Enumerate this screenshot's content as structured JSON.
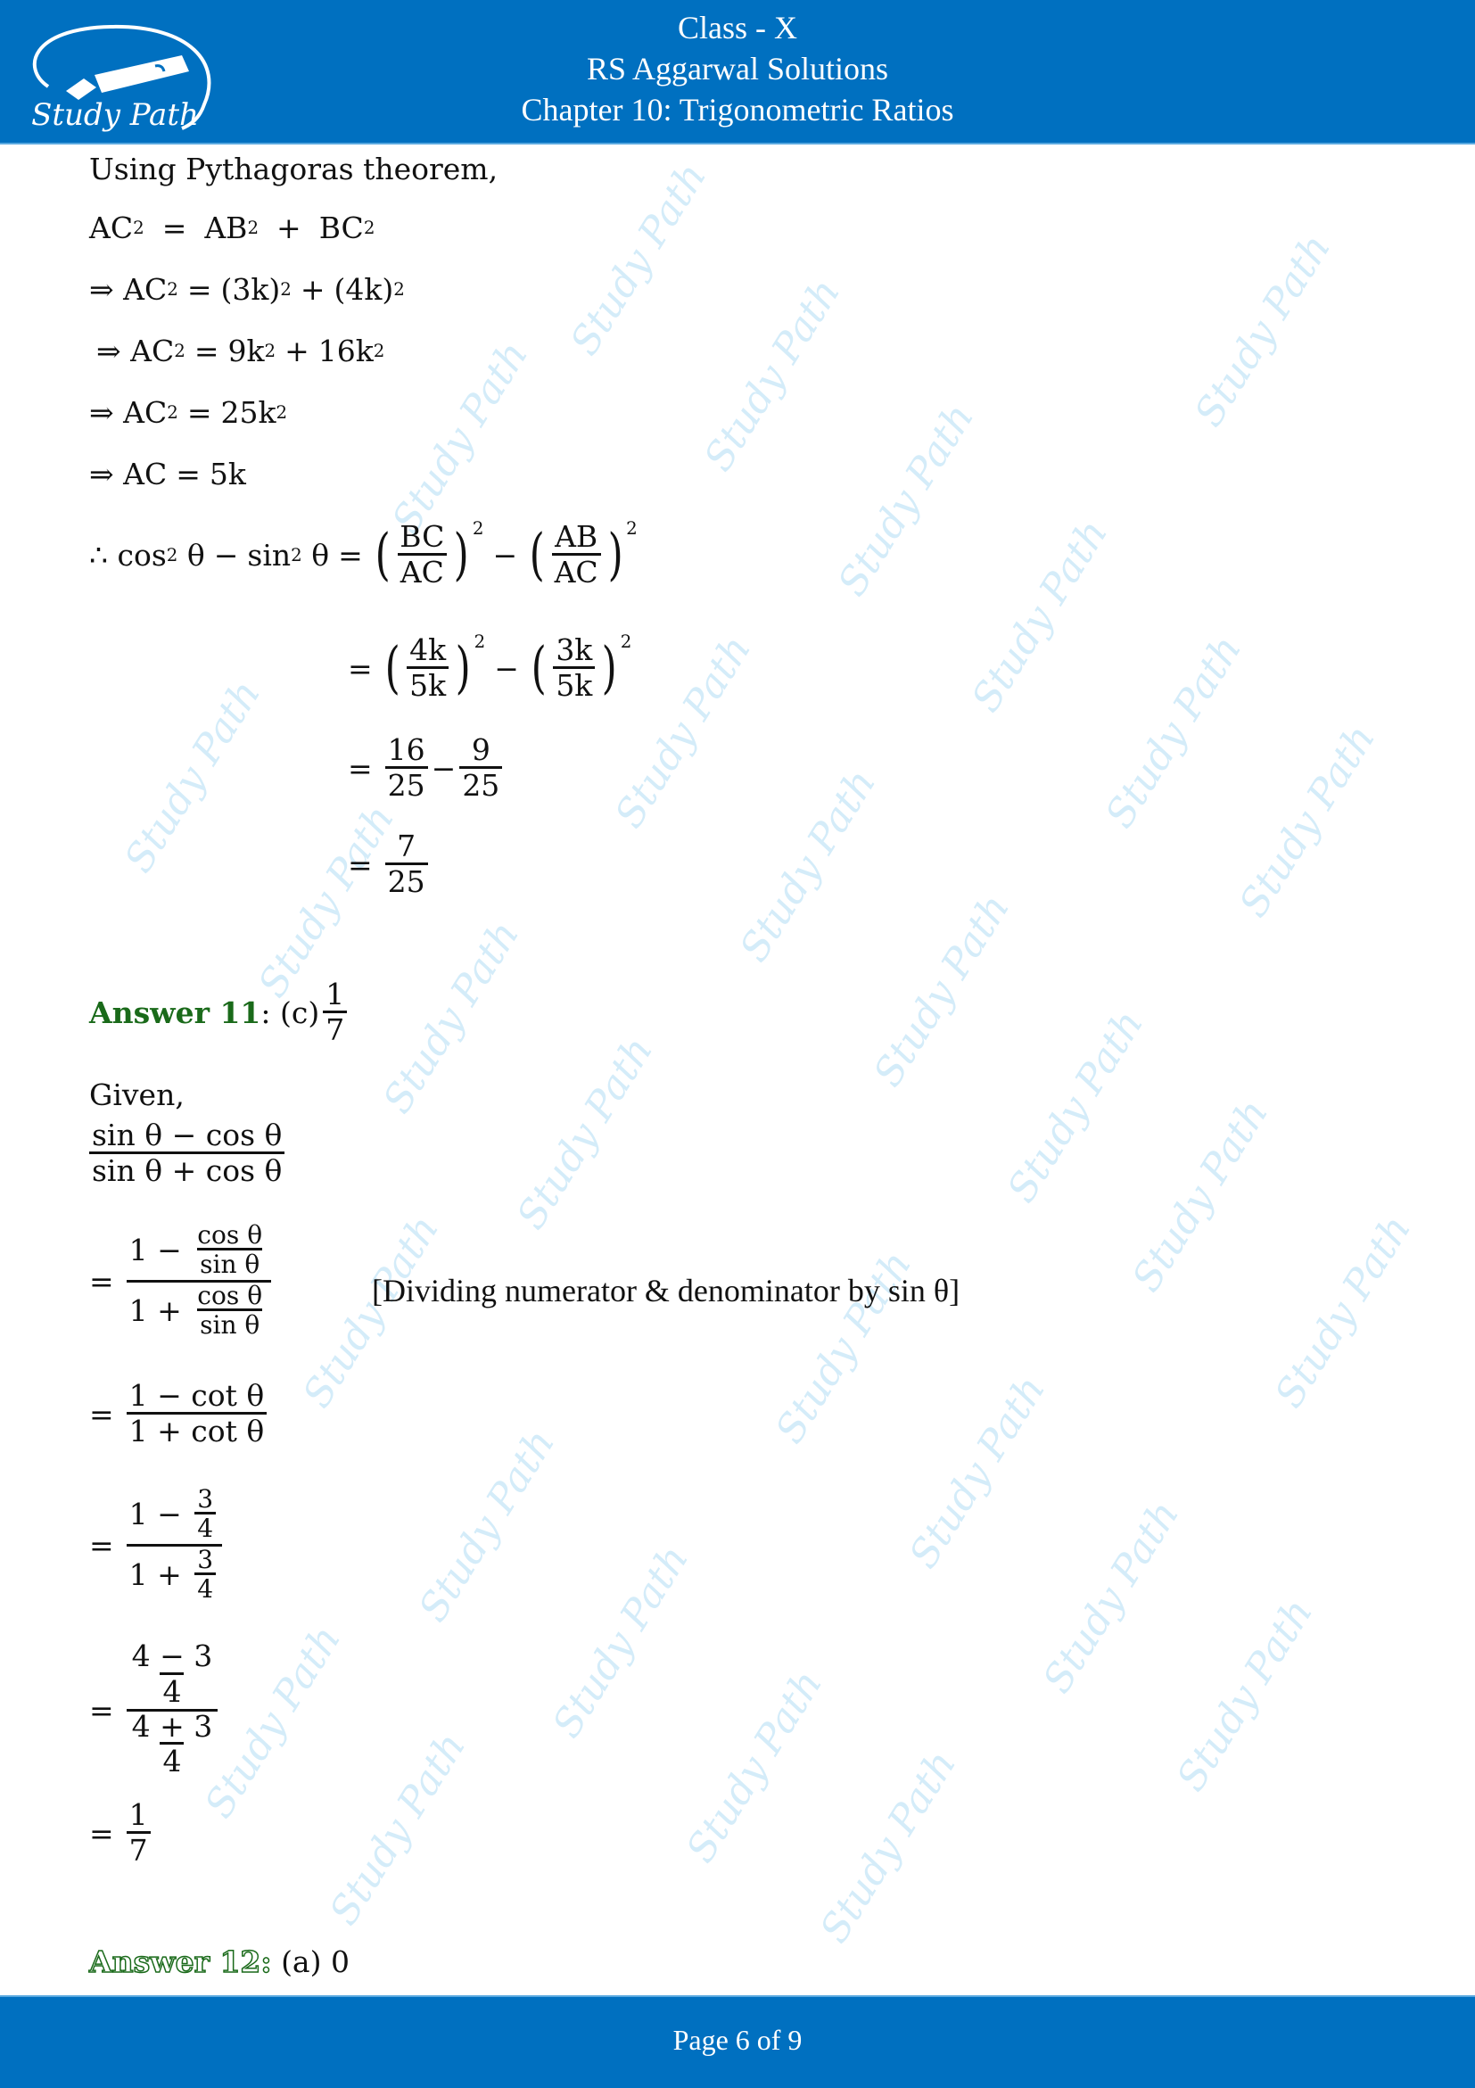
{
  "header": {
    "logo_text": "Study Path",
    "line1": "Class - X",
    "line2": "RS Aggarwal Solutions",
    "line3": "Chapter 10: Trigonometric Ratios"
  },
  "watermark_text": "Study Path",
  "colors": {
    "brand_blue": "#0070c0",
    "answer_green": "#1a6a1a",
    "watermark": "#d4ecf9"
  },
  "content": {
    "intro": "Using Pythagoras theorem,",
    "pyth": {
      "l1": {
        "a": "AC",
        "eq": "=",
        "b": "AB",
        "plus": "+",
        "c": "BC",
        "exp": "2"
      },
      "l2": {
        "arrow": "⇒",
        "lhs": "AC",
        "exp": "2",
        "rhs_a": "(3k)",
        "rhs_b": "(4k)"
      },
      "l3": {
        "arrow": "⇒",
        "lhs": "AC",
        "rhs_a": "9k",
        "rhs_b": "16k"
      },
      "l4": {
        "arrow": "⇒",
        "lhs": "AC",
        "rhs": "25k"
      },
      "l5": {
        "arrow": "⇒",
        "lhs": "AC",
        "rhs": "5k"
      }
    },
    "cos_step": {
      "therefore": "∴",
      "lhs_cos": "cos",
      "lhs_sin": "sin",
      "theta": "θ",
      "minus": "−",
      "eq": "=",
      "f1": {
        "num": "BC",
        "den": "AC"
      },
      "f2": {
        "num": "AB",
        "den": "AC"
      },
      "f3": {
        "num": "4k",
        "den": "5k"
      },
      "f4": {
        "num": "3k",
        "den": "5k"
      },
      "f5": {
        "num": "16",
        "den": "25"
      },
      "f6": {
        "num": "9",
        "den": "25"
      },
      "f7": {
        "num": "7",
        "den": "25"
      }
    },
    "answer11": {
      "label": "Answer 11",
      "colon": ":",
      "option": "(c)",
      "frac": {
        "num": "1",
        "den": "7"
      },
      "given": "Given,",
      "expr": {
        "num": "sin θ − cos θ",
        "den": "sin θ + cos θ"
      },
      "step1": {
        "num_lead": "1 −",
        "num_frac": {
          "num": "cos θ",
          "den": "sin θ"
        },
        "den_lead": "1 +",
        "den_frac": {
          "num": "cos θ",
          "den": "sin θ"
        }
      },
      "note": "[Dividing numerator & denominator by sin θ]",
      "step2": {
        "num": "1 − cot θ",
        "den": "1 + cot θ"
      },
      "step3": {
        "num_lead": "1 −",
        "num_frac": {
          "num": "3",
          "den": "4"
        },
        "den_lead": "1 +",
        "den_frac": {
          "num": "3",
          "den": "4"
        }
      },
      "step4": {
        "num_frac": {
          "num": "4 − 3",
          "den": "4"
        },
        "den_frac": {
          "num": "4 + 3",
          "den": "4"
        }
      },
      "result": {
        "num": "1",
        "den": "7"
      }
    },
    "answer12": {
      "label": "Answer 12:",
      "option": "(a) 0"
    }
  },
  "footer": {
    "page": "Page 6 of 9"
  }
}
